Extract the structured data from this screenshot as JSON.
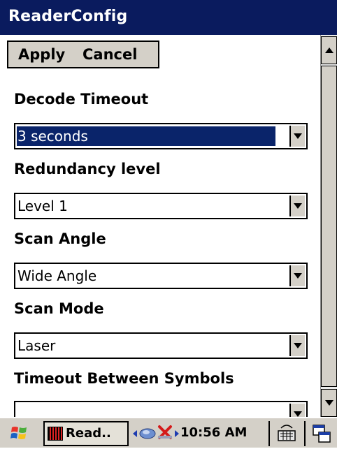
{
  "window": {
    "title": "ReaderConfig"
  },
  "menu": {
    "apply": "Apply",
    "cancel": "Cancel"
  },
  "fields": [
    {
      "label": "Decode Timeout",
      "value": "3 seconds",
      "focused": true
    },
    {
      "label": "Redundancy level",
      "value": "Level 1",
      "focused": false
    },
    {
      "label": "Scan Angle",
      "value": "Wide Angle",
      "focused": false
    },
    {
      "label": "Scan Mode",
      "value": "Laser",
      "focused": false
    },
    {
      "label": "Timeout Between Symbols",
      "value": "",
      "focused": false
    }
  ],
  "taskbar": {
    "task_label": "Read..",
    "clock": "10:56 AM",
    "icons": [
      "windows-start-icon",
      "reader-app-icon",
      "network-icon",
      "disconnected-icon",
      "keyboard-icon",
      "desktop-icon"
    ]
  },
  "colors": {
    "titlebar": "#0a1b5e",
    "selection": "#0a246a",
    "chrome": "#d4d0c8"
  }
}
